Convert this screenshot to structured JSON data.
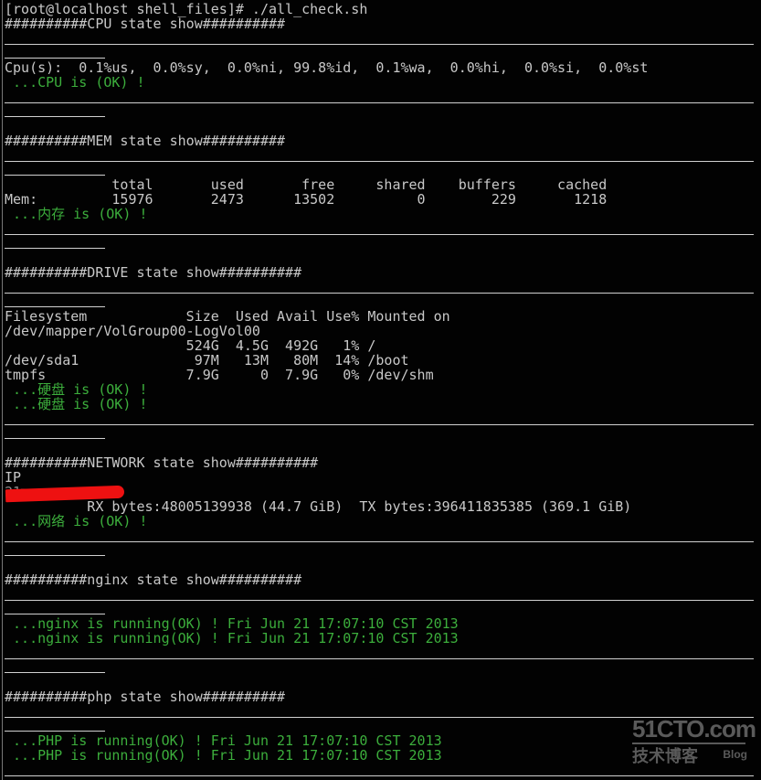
{
  "prompt": "[root@localhost shell_files]# ./all_check.sh",
  "cpu": {
    "header": "##########CPU state show##########",
    "stats": "Cpu(s):  0.1%us,  0.0%sy,  0.0%ni, 99.8%id,  0.1%wa,  0.0%hi,  0.0%si,  0.0%st",
    "status": " ...CPU is (OK) !"
  },
  "mem": {
    "header": "##########MEM state show##########",
    "columns_line": "             total       used       free     shared    buffers     cached",
    "values_line": "Mem:         15976       2473      13502          0        229       1218",
    "columns": [
      "total",
      "used",
      "free",
      "shared",
      "buffers",
      "cached"
    ],
    "row_label": "Mem:",
    "values": [
      "15976",
      "2473",
      "13502",
      "0",
      "229",
      "1218"
    ],
    "status": " ...内存 is (OK) !"
  },
  "drive": {
    "header": "##########DRIVE state show##########",
    "lines": [
      "Filesystem            Size  Used Avail Use% Mounted on",
      "/dev/mapper/VolGroup00-LogVol00",
      "                      524G  4.5G  492G   1% /",
      "/dev/sda1              97M   13M   80M  14% /boot",
      "tmpfs                 7.9G     0  7.9G   0% /dev/shm"
    ],
    "status": [
      " ...硬盘 is (OK) !",
      " ...硬盘 is (OK) !"
    ]
  },
  "network": {
    "header": "##########NETWORK state show##########",
    "ip_label": "IP",
    "ip_value_redacted": "21■.■■.■■■",
    "traffic": "          RX bytes:48005139938 (44.7 GiB)  TX bytes:396411835385 (369.1 GiB)",
    "status": " ...网络 is (OK) !"
  },
  "nginx": {
    "header": "##########nginx state show##########",
    "status": [
      " ...nginx is running(OK) ! Fri Jun 21 17:07:10 CST 2013",
      " ...nginx is running(OK) ! Fri Jun 21 17:07:10 CST 2013"
    ]
  },
  "php": {
    "header": "##########php state show##########",
    "status": [
      " ...PHP is running(OK) ! Fri Jun 21 17:07:10 CST 2013",
      " ...PHP is running(OK) ! Fri Jun 21 17:07:10 CST 2013"
    ]
  },
  "watermark": {
    "brand": "51CTO.com",
    "subtitle": "技术博客",
    "tag": "Blog"
  },
  "colors": {
    "background": "#020202",
    "text": "#c8c8c8",
    "ok_green": "#3cae3c",
    "redaction": "#ee1111"
  }
}
